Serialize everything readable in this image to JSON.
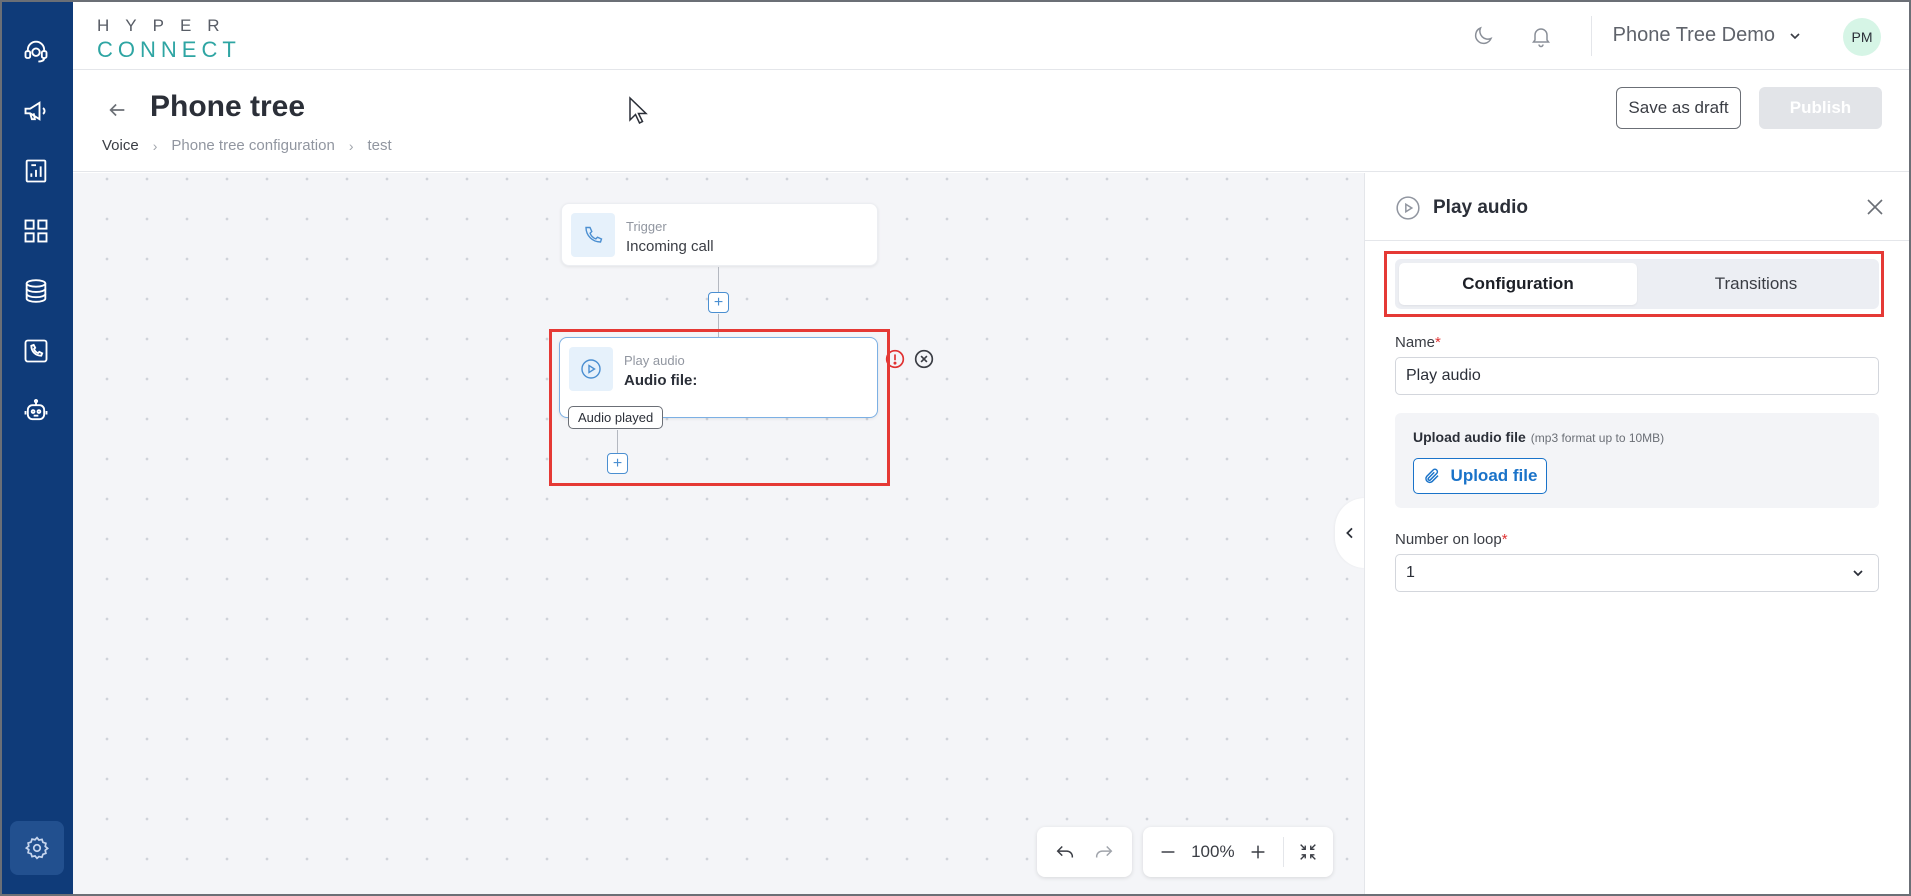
{
  "logo": {
    "line1": "HYPER",
    "line2": "CONNECT"
  },
  "header": {
    "workspace": "Phone Tree Demo",
    "avatar_initials": "PM"
  },
  "page": {
    "title": "Phone tree",
    "breadcrumb": [
      "Voice",
      "Phone tree configuration",
      "test"
    ],
    "save_draft_label": "Save as draft",
    "publish_label": "Publish"
  },
  "canvas": {
    "trigger_node": {
      "label": "Trigger",
      "value": "Incoming call"
    },
    "audio_node": {
      "label": "Play audio",
      "value": "Audio file:"
    },
    "transition_pill": "Audio played",
    "zoom": "100%"
  },
  "panel": {
    "title": "Play audio",
    "tabs": [
      "Configuration",
      "Transitions"
    ],
    "active_tab": "Configuration",
    "name_label": "Name",
    "name_value": "Play audio",
    "upload_title": "Upload audio file",
    "upload_hint": "(mp3 format up to 10MB)",
    "upload_button": "Upload file",
    "loop_label": "Number on loop",
    "loop_value": "1",
    "required_mark": "*"
  },
  "colors": {
    "sidebar": "#0f3b79",
    "accent": "#1a73c9",
    "logo_teal": "#2ea5a3",
    "highlight_red": "#e53935",
    "warning": "#e03131"
  },
  "icons": {
    "sidebar": [
      "headset-icon",
      "megaphone-icon",
      "report-icon",
      "dashboard-icon",
      "database-icon",
      "phone-icon",
      "bot-icon",
      "gear-icon"
    ],
    "header": [
      "moon-icon",
      "bell-icon",
      "chevron-down-icon"
    ]
  }
}
